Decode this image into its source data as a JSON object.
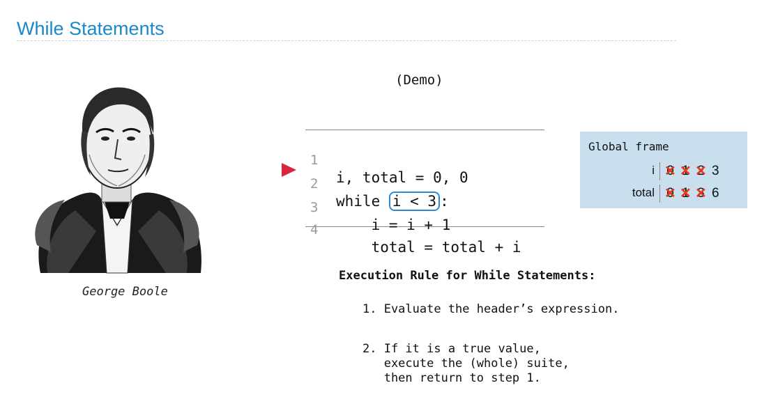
{
  "slide": {
    "title": "While Statements",
    "demo_label": "(Demo)",
    "portrait_caption": "George Boole"
  },
  "code": {
    "lines": [
      {
        "num": "1",
        "text": "i, total = 0, 0"
      },
      {
        "num": "2",
        "prefix": "while ",
        "condition": "i < 3",
        "suffix": ":"
      },
      {
        "num": "3",
        "text": "    i = i + 1"
      },
      {
        "num": "4",
        "text": "    total = total + i"
      }
    ],
    "current_line_indicator": "arrow-right-red",
    "colors": {
      "arrow": "#d8263b",
      "condition_box": "#2a8ad6"
    }
  },
  "frame": {
    "title": "Global frame",
    "variables": [
      {
        "name": "i",
        "old_values": [
          "0",
          "1",
          "2"
        ],
        "value": "3"
      },
      {
        "name": "total",
        "old_values": [
          "0",
          "1",
          "3"
        ],
        "value": "6"
      }
    ],
    "colors": {
      "background": "#c9dfee",
      "strike": "#e33a18"
    }
  },
  "rule": {
    "title": "Execution Rule for While Statements:",
    "step1": "1. Evaluate the header’s expression.",
    "step2_line1": "2. If it is a true value,",
    "step2_line2": "   execute the (whole) suite,",
    "step2_line3": "   then return to step 1."
  }
}
